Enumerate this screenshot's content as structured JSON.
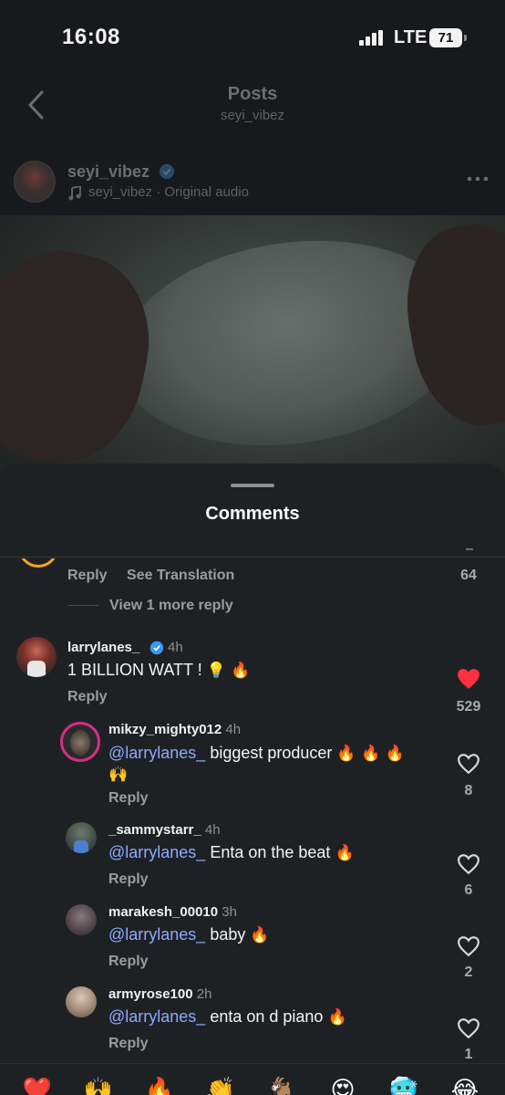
{
  "status": {
    "time": "16:08",
    "network": "LTE",
    "battery": "71"
  },
  "header": {
    "title": "Posts",
    "subtitle": "seyi_vibez"
  },
  "post": {
    "username": "seyi_vibez",
    "audio": "seyi_vibez · Original audio"
  },
  "comments_sheet": {
    "title": "Comments",
    "partial": {
      "reply": "Reply",
      "translate": "See Translation",
      "likes": "64",
      "view_replies": "View 1 more reply"
    },
    "comments": [
      {
        "username": "larrylanes_",
        "time": "4h",
        "verified": true,
        "text": "1 BILLION WATT !",
        "emoji": "💡 🔥",
        "reply": "Reply",
        "likes": "529",
        "liked": true
      }
    ],
    "replies": [
      {
        "username": "mikzy_mighty012",
        "time": "4h",
        "mention": "@larrylanes_",
        "text": " biggest producer ",
        "emoji": "🔥 🔥 🔥",
        "emoji2": "🙌",
        "reply": "Reply",
        "likes": "8"
      },
      {
        "username": "_sammystarr_",
        "time": "4h",
        "mention": "@larrylanes_",
        "text": " Enta on the beat ",
        "emoji": "🔥",
        "reply": "Reply",
        "likes": "6"
      },
      {
        "username": "marakesh_00010",
        "time": "3h",
        "mention": "@larrylanes_",
        "text": " baby ",
        "emoji": "🔥",
        "reply": "Reply",
        "likes": "2"
      },
      {
        "username": "armyrose100",
        "time": "2h",
        "mention": "@larrylanes_",
        "text": " enta on d piano ",
        "emoji": "🔥",
        "reply": "Reply",
        "likes": "1"
      }
    ]
  },
  "reactions": [
    "❤️",
    "🙌",
    "🔥",
    "👏",
    "🐐",
    "😍",
    "🥶",
    "😂"
  ],
  "colors": {
    "accent_heart": "#ff3040",
    "mention": "#8fa9ff",
    "verified": "#3897f0",
    "story_ring": "#f5a623"
  }
}
